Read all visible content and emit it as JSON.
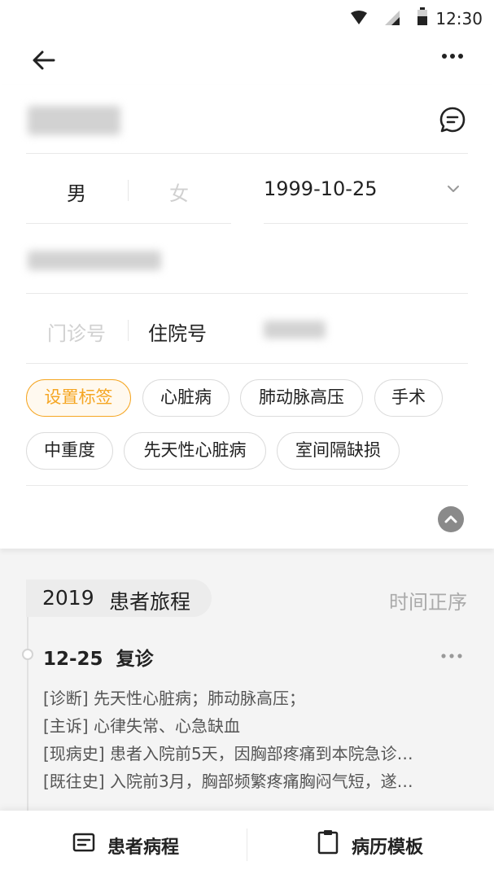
{
  "status_bar": {
    "time": "12:30"
  },
  "patient": {
    "gender_options": [
      "男",
      "女"
    ],
    "selected_gender": "男",
    "birth_date": "1999-10-25",
    "id_types": [
      "门诊号",
      "住院号"
    ],
    "selected_id_type": "住院号"
  },
  "tags": [
    {
      "label": "设置标签"
    },
    {
      "label": "心脏病"
    },
    {
      "label": "肺动脉高压"
    },
    {
      "label": "手术"
    },
    {
      "label": "中重度"
    },
    {
      "label": "先天性心脏病"
    },
    {
      "label": "室间隔缺损"
    }
  ],
  "journey": {
    "year": "2019",
    "title": "患者旅程",
    "sort_label": "时间正序",
    "visit": {
      "date": "12-25",
      "type": "复诊",
      "records": [
        "[诊断] 先天性心脏病；肺动脉高压；",
        "[主诉] 心律失常、心急缺血",
        "[现病史] 患者入院前5天，因胸部疼痛到本院急诊…",
        "[既往史] 入院前3月，胸部频繁疼痛胸闷气短，遂…"
      ]
    }
  },
  "bottom_nav": {
    "left_label": "患者病程",
    "right_label": "病历模板"
  },
  "colors": {
    "accent": "#f5a623",
    "muted": "#aaaaaa"
  }
}
